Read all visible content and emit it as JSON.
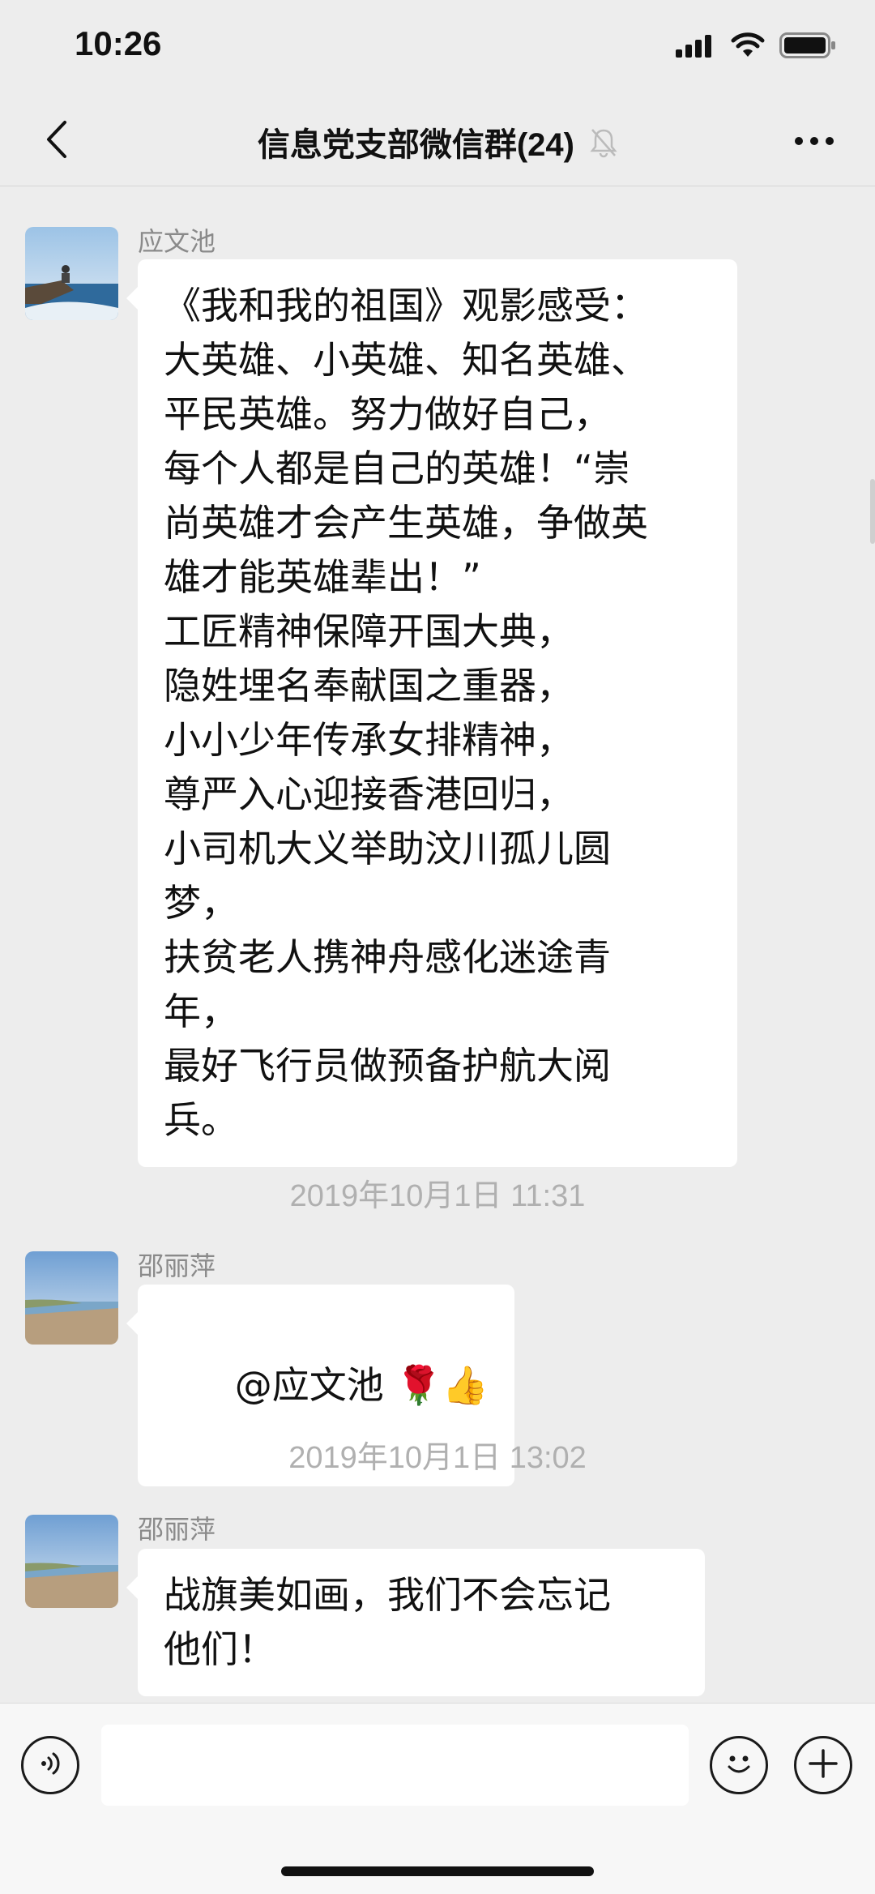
{
  "status_bar": {
    "time": "10:26"
  },
  "header": {
    "title": "信息党支部微信群(24)",
    "back_icon": "chevron-left-icon",
    "mute_icon": "bell-off-icon",
    "more_icon": "more-dots-icon"
  },
  "messages": [
    {
      "sender": "应文池",
      "text": "《我和我的祖国》观影感受：\n大英雄、小英雄、知名英雄、\n平民英雄。努力做好自己，\n每个人都是自己的英雄！“崇\n尚英雄才会产生英雄，争做英\n雄才能英雄辈出！”\n工匠精神保障开国大典，\n隐姓埋名奉献国之重器，\n小小少年传承女排精神，\n尊严入心迎接香港回归，\n小司机大义举助汶川孤儿圆\n梦，\n扶贫老人携神舟感化迷途青\n年，\n最好飞行员做预备护航大阅\n兵。"
    },
    {
      "timestamp": "2019年10月1日 11:31",
      "sender": "邵丽萍",
      "text": "@应文池 ",
      "emoji": "🌹👍"
    },
    {
      "timestamp": "2019年10月1日 13:02",
      "sender": "邵丽萍",
      "text": "战旗美如画，我们不会忘记\n他们！"
    }
  ],
  "input_bar": {
    "voice_icon": "voice-icon",
    "input_value": "",
    "emoji_icon": "smile-icon",
    "plus_icon": "plus-icon"
  },
  "colors": {
    "background": "#ededed",
    "bubble": "#ffffff",
    "timestamp": "#b0b0b0",
    "sender": "#8a8a8a"
  }
}
